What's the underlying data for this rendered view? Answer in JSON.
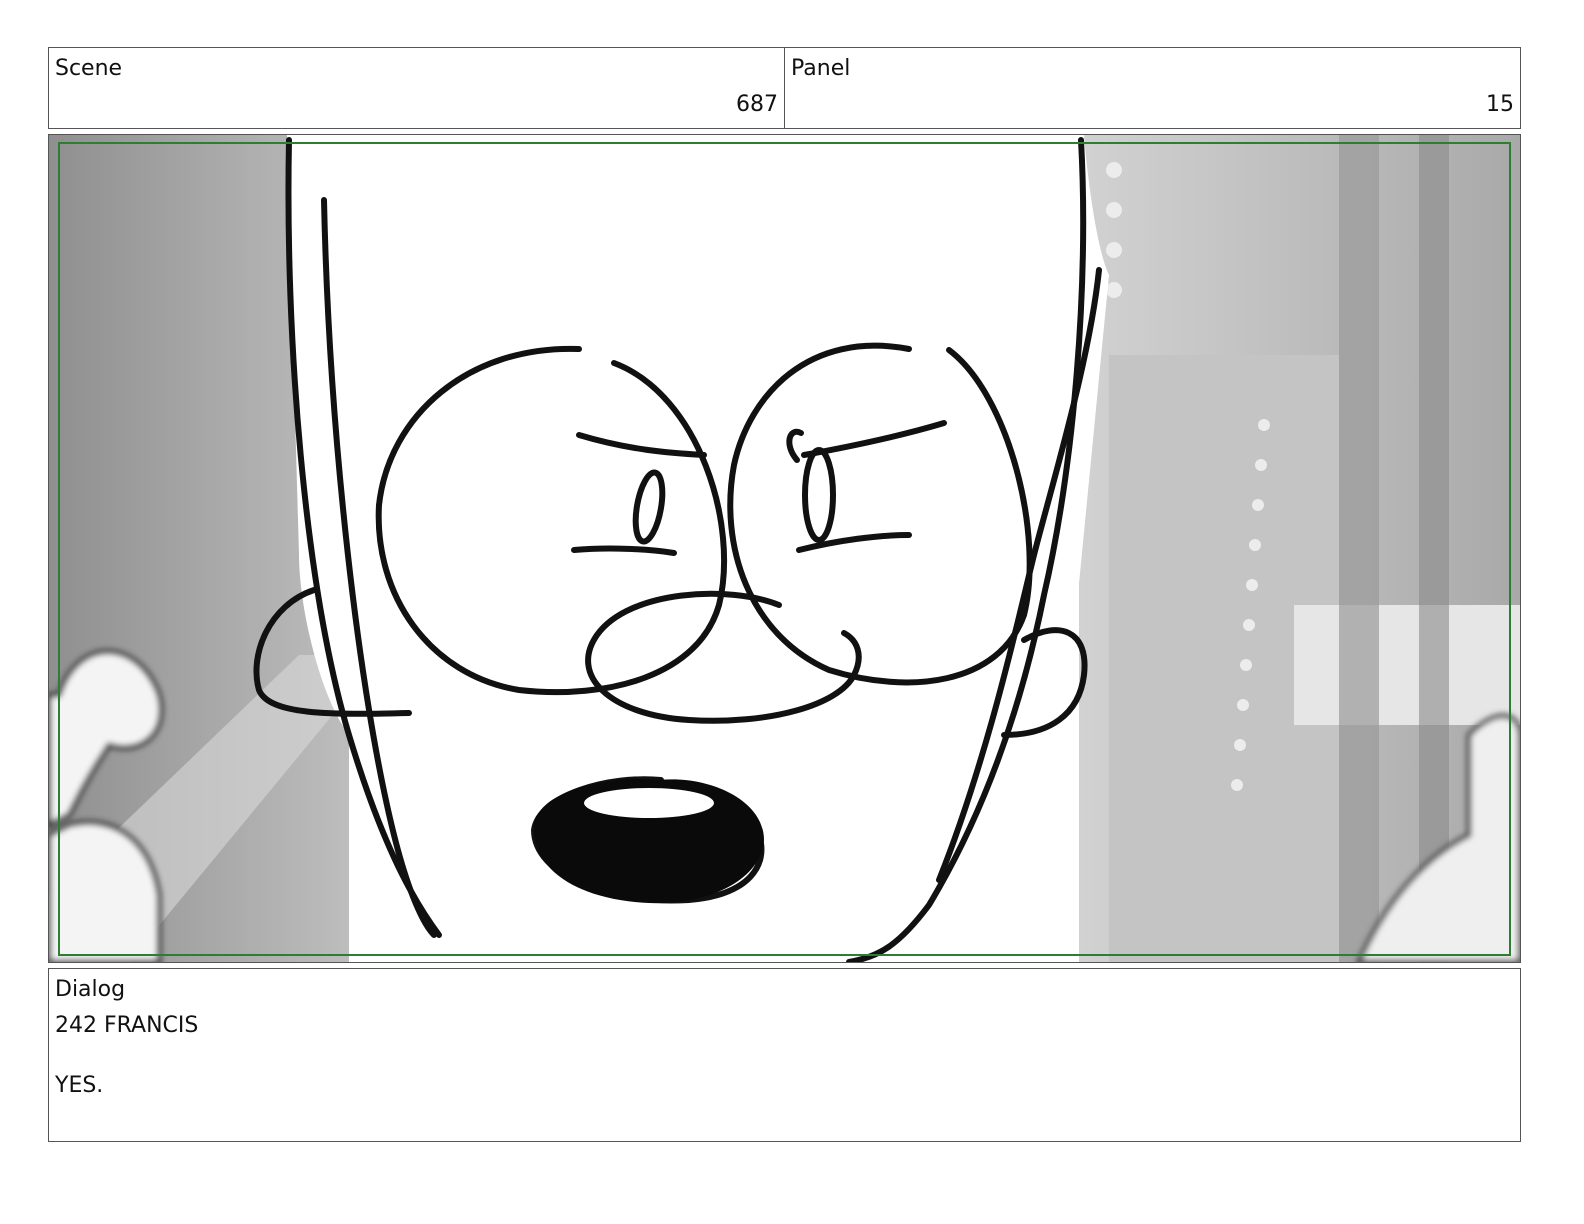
{
  "header": {
    "scene_label": "Scene",
    "scene_number": "687",
    "panel_label": "Panel",
    "panel_number": "15"
  },
  "frame": {
    "border_color": "#2e7d32"
  },
  "dialog": {
    "label": "Dialog",
    "speaker_line": "242 FRANCIS",
    "text": "YES."
  }
}
